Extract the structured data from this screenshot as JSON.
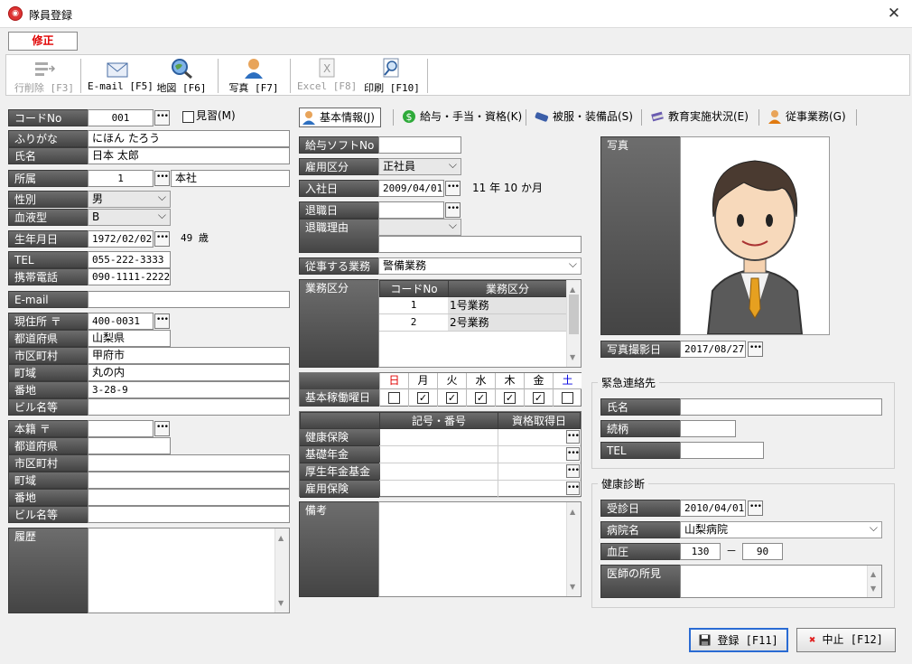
{
  "window": {
    "title": "隊員登録",
    "close": "✕",
    "mode": "修正"
  },
  "toolbar": {
    "delete": "行削除 [F3]",
    "email": "E-mail [F5]",
    "map": "地図 [F6]",
    "photo": "写真 [F7]",
    "excel": "Excel [F8]",
    "print": "印刷 [F10]"
  },
  "left": {
    "code_label": "コードNo",
    "code_value": "001",
    "trainee_label": "見習(M)",
    "furigana_label": "ふりがな",
    "furigana_value": "にほん たろう",
    "name_label": "氏名",
    "name_value": "日本 太郎",
    "dept_label": "所属",
    "dept_code": "1",
    "dept_name": "本社",
    "gender_label": "性別",
    "gender_value": "男",
    "blood_label": "血液型",
    "blood_value": "B",
    "birth_label": "生年月日",
    "birth_value": "1972/02/02",
    "age": "49 歳",
    "tel_label": "TEL",
    "tel_value": "055-222-3333",
    "mobile_label": "携帯電話",
    "mobile_value": "090-1111-2222",
    "email_label": "E-mail",
    "email_value": "",
    "addr_label": "現住所 〒",
    "addr_zip": "400-0031",
    "pref_label": "都道府県",
    "pref_value": "山梨県",
    "city_label": "市区町村",
    "city_value": "甲府市",
    "area_label": "町域",
    "area_value": "丸の内",
    "num_label": "番地",
    "num_value": "3-28-9",
    "bldg_label": "ビル名等",
    "bldg_value": "",
    "honseki_label": "本籍 〒",
    "honseki_zip": "",
    "h_pref_label": "都道府県",
    "h_city_label": "市区町村",
    "h_area_label": "町域",
    "h_num_label": "番地",
    "h_bldg_label": "ビル名等",
    "history_label": "履歴"
  },
  "tabs": [
    "基本情報(J)",
    "給与・手当・資格(K)",
    "被服・装備品(S)",
    "教育実施状況(E)",
    "従事業務(G)"
  ],
  "mid": {
    "payroll_label": "給与ソフトNo",
    "payroll_value": "",
    "emp_label": "雇用区分",
    "emp_value": "正社員",
    "join_label": "入社日",
    "join_value": "2009/04/01",
    "tenure": "11 年 10 か月",
    "retire_label": "退職日",
    "retire_reason_label": "退職理由",
    "duty_label": "従事する業務",
    "duty_value": "警備業務",
    "task_label": "業務区分",
    "task_cols": [
      "コードNo",
      "業務区分"
    ],
    "tasks": [
      {
        "code": "1",
        "name": "1号業務"
      },
      {
        "code": "2",
        "name": "2号業務"
      }
    ],
    "days": [
      "日",
      "月",
      "火",
      "水",
      "木",
      "金",
      "土"
    ],
    "days_checked": [
      false,
      true,
      true,
      true,
      true,
      true,
      false
    ],
    "workday_label": "基本稼働曜日",
    "ins_cols": [
      "記号・番号",
      "資格取得日"
    ],
    "ins_rows": [
      "健康保険",
      "基礎年金",
      "厚生年金基金",
      "雇用保険"
    ],
    "notes_label": "備考"
  },
  "right": {
    "photo_label": "写真",
    "photo_date_label": "写真撮影日",
    "photo_date": "2017/08/27",
    "emergency_title": "緊急連絡先",
    "e_name_label": "氏名",
    "e_rel_label": "続柄",
    "e_tel_label": "TEL",
    "health_title": "健康診断",
    "exam_label": "受診日",
    "exam_date": "2010/04/01",
    "hospital_label": "病院名",
    "hospital_value": "山梨病院",
    "bp_label": "血圧",
    "bp_high": "130",
    "bp_sep": "－",
    "bp_low": "90",
    "doctor_label": "医師の所見"
  },
  "buttons": {
    "save": "登録 [F11]",
    "cancel": "中止 [F12]"
  },
  "colors": {
    "sunday": "#e00000",
    "saturday": "#0000e0",
    "accent": "#2a6bd3"
  }
}
